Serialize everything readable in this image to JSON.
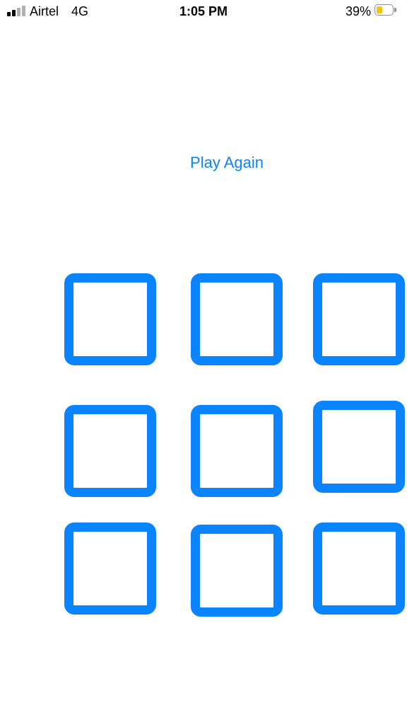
{
  "status_bar": {
    "carrier": "Airtel",
    "network": "4G",
    "time": "1:05 PM",
    "battery_percent": "39%",
    "battery_level": 0.39,
    "signal_bars_active": 2,
    "signal_bars_total": 4,
    "signal_active_color": "#000000",
    "signal_inactive_color": "#b0b0b0",
    "battery_fill_color": "#f4c20d"
  },
  "main": {
    "play_again_label": "Play Again",
    "accent_color": "#0a84ff"
  },
  "board": {
    "cell_count": 9,
    "cells": [
      "",
      "",
      "",
      "",
      "",
      "",
      "",
      "",
      ""
    ]
  }
}
